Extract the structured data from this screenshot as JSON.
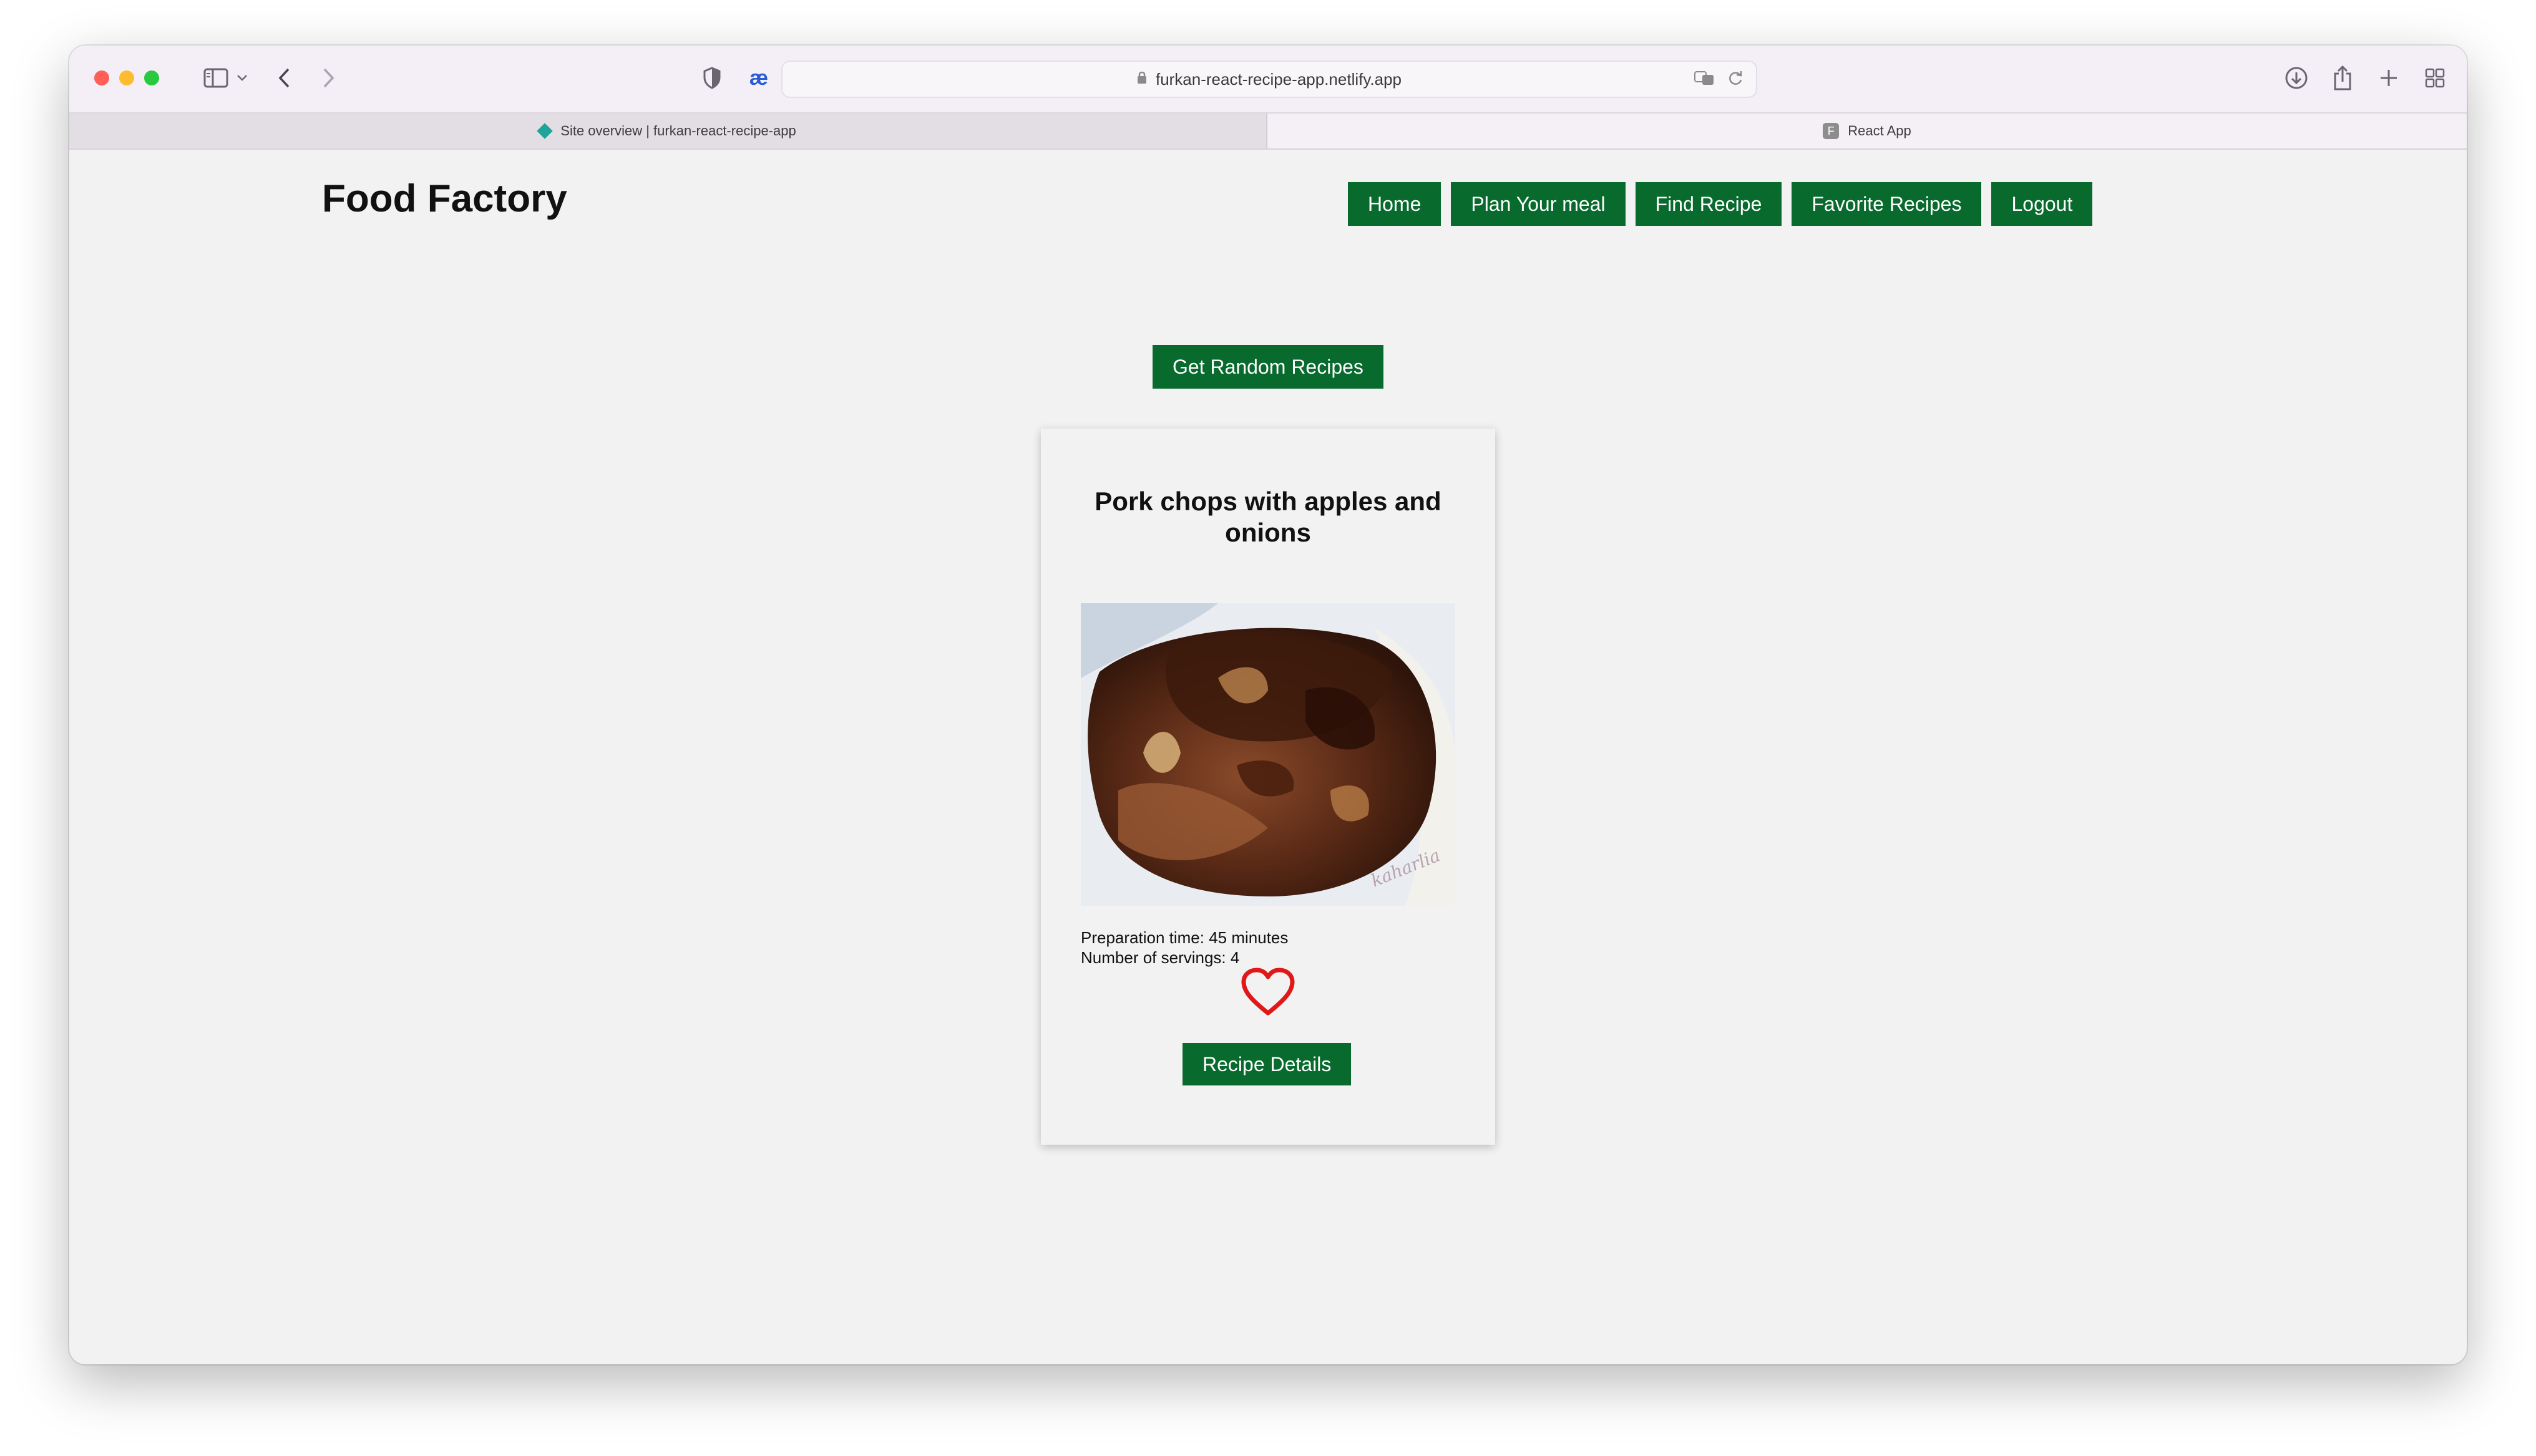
{
  "browser": {
    "url": "furkan-react-recipe-app.netlify.app",
    "tabs": [
      {
        "label": "Site overview | furkan-react-recipe-app"
      },
      {
        "label": "React App"
      }
    ]
  },
  "header": {
    "brand": "Food Factory",
    "nav": [
      {
        "label": "Home"
      },
      {
        "label": "Plan Your meal"
      },
      {
        "label": "Find Recipe"
      },
      {
        "label": "Favorite Recipes"
      },
      {
        "label": "Logout"
      }
    ]
  },
  "main": {
    "random_button": "Get Random Recipes",
    "recipe": {
      "title": "Pork chops with apples and onions",
      "prep_time": "Preparation time: 45 minutes",
      "servings": "Number of servings: 4",
      "favorite_icon": "heart-outline-icon",
      "details_button": "Recipe Details"
    }
  },
  "colors": {
    "accent": "#086a2d",
    "heart": "#e01818",
    "page_background": "#f2f2f2"
  }
}
